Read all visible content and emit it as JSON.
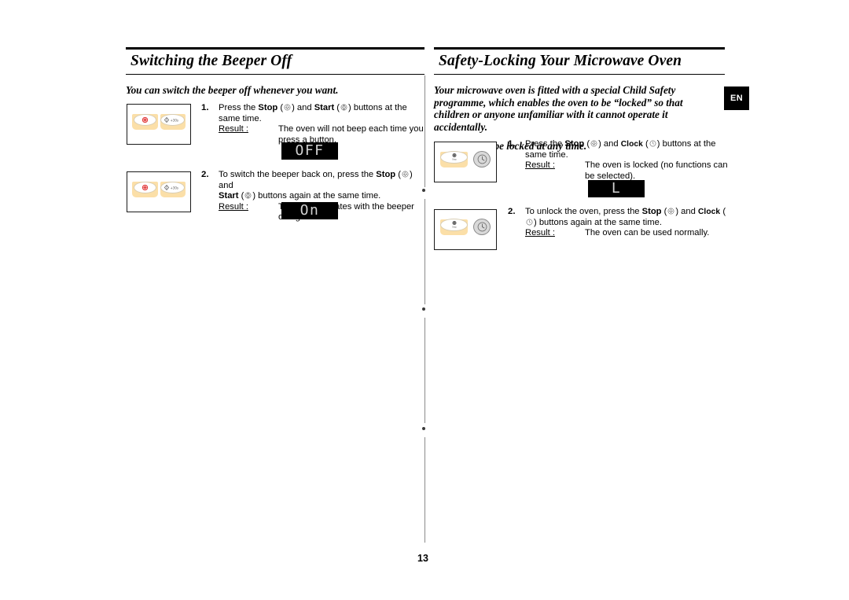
{
  "page": {
    "number": "13",
    "language_badge": "EN"
  },
  "left_section": {
    "heading": "Switching the Beeper Off",
    "lead": "You can switch the beeper off whenever you want.",
    "steps": [
      {
        "number": "1.",
        "text_parts": {
          "a": "Press the ",
          "stop_label": "Stop",
          "b": " (",
          "c": ") and ",
          "start_label": "Start",
          "d": "(",
          "e": ") buttons at the same time."
        },
        "result_label": "Result :",
        "result_text": "The oven will not beep each time you press a button.",
        "display": "OFF",
        "panel": {
          "left_key": "stop-key",
          "right_key": "start-plus-30s-key",
          "right_key_label": "+30s"
        }
      },
      {
        "number": "2.",
        "text_parts": {
          "a": "To switch the beeper back on, press the ",
          "stop_label": "Stop",
          "b": " (",
          "c": ") and ",
          "start_label": "Start",
          "d": "(",
          "e": ") buttons again at the same time."
        },
        "result_label": "Result :",
        "result_text": "The oven operates with the beeper on again.",
        "display": "On",
        "panel": {
          "left_key": "stop-key",
          "right_key": "start-plus-30s-key",
          "right_key_label": "+30s"
        }
      }
    ]
  },
  "right_section": {
    "heading": "Safety-Locking Your Microwave Oven",
    "lead": "Your microwave oven is fitted with a special Child Safety programme, which enables the oven to be “locked” so that children or anyone unfamiliar with it cannot operate it accidentally.",
    "lead_sub": "The oven can be locked at any time.",
    "steps": [
      {
        "number": "1.",
        "text_parts": {
          "a": "Press the ",
          "stop_label": "Stop",
          "b": " (",
          "c": ") and ",
          "clock_label": "Clock",
          "d": "(",
          "e": ") buttons at the same time."
        },
        "result_label": "Result :",
        "result_text": "The oven is locked (no functions can be selected).",
        "display": "L",
        "panel": {
          "left_key": "stop-key",
          "right_key": "clock-key"
        }
      },
      {
        "number": "2.",
        "text_parts": {
          "a": "To unlock the oven, press the ",
          "stop_label": "Stop",
          "b": " (",
          "c": ") and ",
          "clock_label": "Clock",
          "d": "(",
          "e": ") buttons again at the same time."
        },
        "result_label": "Result :",
        "result_text": "The oven can be used normally.",
        "display": null,
        "panel": {
          "left_key": "stop-key",
          "right_key": "clock-key"
        }
      }
    ]
  },
  "colors": {
    "keycap_tan": "#fbdfa8",
    "led_background": "#000000",
    "led_text": "#d2d2d2",
    "stop_icon_red": "#e23b3b",
    "circle_button_grey": "#d9d9d9"
  }
}
